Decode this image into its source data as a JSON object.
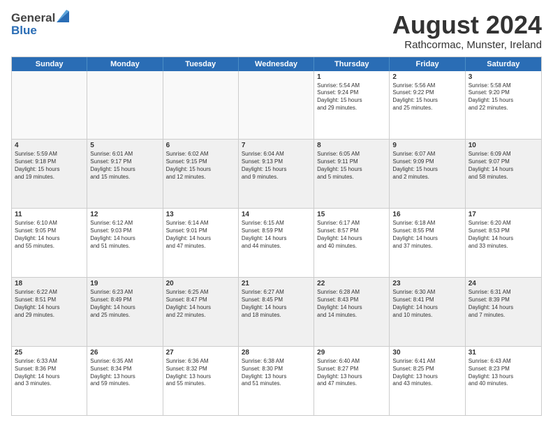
{
  "logo": {
    "general": "General",
    "blue": "Blue"
  },
  "title": "August 2024",
  "subtitle": "Rathcormac, Munster, Ireland",
  "header_days": [
    "Sunday",
    "Monday",
    "Tuesday",
    "Wednesday",
    "Thursday",
    "Friday",
    "Saturday"
  ],
  "rows": [
    [
      {
        "day": "",
        "text": "",
        "empty": true
      },
      {
        "day": "",
        "text": "",
        "empty": true
      },
      {
        "day": "",
        "text": "",
        "empty": true
      },
      {
        "day": "",
        "text": "",
        "empty": true
      },
      {
        "day": "1",
        "text": "Sunrise: 5:54 AM\nSunset: 9:24 PM\nDaylight: 15 hours\nand 29 minutes.",
        "empty": false
      },
      {
        "day": "2",
        "text": "Sunrise: 5:56 AM\nSunset: 9:22 PM\nDaylight: 15 hours\nand 25 minutes.",
        "empty": false
      },
      {
        "day": "3",
        "text": "Sunrise: 5:58 AM\nSunset: 9:20 PM\nDaylight: 15 hours\nand 22 minutes.",
        "empty": false
      }
    ],
    [
      {
        "day": "4",
        "text": "Sunrise: 5:59 AM\nSunset: 9:18 PM\nDaylight: 15 hours\nand 19 minutes.",
        "empty": false
      },
      {
        "day": "5",
        "text": "Sunrise: 6:01 AM\nSunset: 9:17 PM\nDaylight: 15 hours\nand 15 minutes.",
        "empty": false
      },
      {
        "day": "6",
        "text": "Sunrise: 6:02 AM\nSunset: 9:15 PM\nDaylight: 15 hours\nand 12 minutes.",
        "empty": false
      },
      {
        "day": "7",
        "text": "Sunrise: 6:04 AM\nSunset: 9:13 PM\nDaylight: 15 hours\nand 9 minutes.",
        "empty": false
      },
      {
        "day": "8",
        "text": "Sunrise: 6:05 AM\nSunset: 9:11 PM\nDaylight: 15 hours\nand 5 minutes.",
        "empty": false
      },
      {
        "day": "9",
        "text": "Sunrise: 6:07 AM\nSunset: 9:09 PM\nDaylight: 15 hours\nand 2 minutes.",
        "empty": false
      },
      {
        "day": "10",
        "text": "Sunrise: 6:09 AM\nSunset: 9:07 PM\nDaylight: 14 hours\nand 58 minutes.",
        "empty": false
      }
    ],
    [
      {
        "day": "11",
        "text": "Sunrise: 6:10 AM\nSunset: 9:05 PM\nDaylight: 14 hours\nand 55 minutes.",
        "empty": false
      },
      {
        "day": "12",
        "text": "Sunrise: 6:12 AM\nSunset: 9:03 PM\nDaylight: 14 hours\nand 51 minutes.",
        "empty": false
      },
      {
        "day": "13",
        "text": "Sunrise: 6:14 AM\nSunset: 9:01 PM\nDaylight: 14 hours\nand 47 minutes.",
        "empty": false
      },
      {
        "day": "14",
        "text": "Sunrise: 6:15 AM\nSunset: 8:59 PM\nDaylight: 14 hours\nand 44 minutes.",
        "empty": false
      },
      {
        "day": "15",
        "text": "Sunrise: 6:17 AM\nSunset: 8:57 PM\nDaylight: 14 hours\nand 40 minutes.",
        "empty": false
      },
      {
        "day": "16",
        "text": "Sunrise: 6:18 AM\nSunset: 8:55 PM\nDaylight: 14 hours\nand 37 minutes.",
        "empty": false
      },
      {
        "day": "17",
        "text": "Sunrise: 6:20 AM\nSunset: 8:53 PM\nDaylight: 14 hours\nand 33 minutes.",
        "empty": false
      }
    ],
    [
      {
        "day": "18",
        "text": "Sunrise: 6:22 AM\nSunset: 8:51 PM\nDaylight: 14 hours\nand 29 minutes.",
        "empty": false
      },
      {
        "day": "19",
        "text": "Sunrise: 6:23 AM\nSunset: 8:49 PM\nDaylight: 14 hours\nand 25 minutes.",
        "empty": false
      },
      {
        "day": "20",
        "text": "Sunrise: 6:25 AM\nSunset: 8:47 PM\nDaylight: 14 hours\nand 22 minutes.",
        "empty": false
      },
      {
        "day": "21",
        "text": "Sunrise: 6:27 AM\nSunset: 8:45 PM\nDaylight: 14 hours\nand 18 minutes.",
        "empty": false
      },
      {
        "day": "22",
        "text": "Sunrise: 6:28 AM\nSunset: 8:43 PM\nDaylight: 14 hours\nand 14 minutes.",
        "empty": false
      },
      {
        "day": "23",
        "text": "Sunrise: 6:30 AM\nSunset: 8:41 PM\nDaylight: 14 hours\nand 10 minutes.",
        "empty": false
      },
      {
        "day": "24",
        "text": "Sunrise: 6:31 AM\nSunset: 8:39 PM\nDaylight: 14 hours\nand 7 minutes.",
        "empty": false
      }
    ],
    [
      {
        "day": "25",
        "text": "Sunrise: 6:33 AM\nSunset: 8:36 PM\nDaylight: 14 hours\nand 3 minutes.",
        "empty": false
      },
      {
        "day": "26",
        "text": "Sunrise: 6:35 AM\nSunset: 8:34 PM\nDaylight: 13 hours\nand 59 minutes.",
        "empty": false
      },
      {
        "day": "27",
        "text": "Sunrise: 6:36 AM\nSunset: 8:32 PM\nDaylight: 13 hours\nand 55 minutes.",
        "empty": false
      },
      {
        "day": "28",
        "text": "Sunrise: 6:38 AM\nSunset: 8:30 PM\nDaylight: 13 hours\nand 51 minutes.",
        "empty": false
      },
      {
        "day": "29",
        "text": "Sunrise: 6:40 AM\nSunset: 8:27 PM\nDaylight: 13 hours\nand 47 minutes.",
        "empty": false
      },
      {
        "day": "30",
        "text": "Sunrise: 6:41 AM\nSunset: 8:25 PM\nDaylight: 13 hours\nand 43 minutes.",
        "empty": false
      },
      {
        "day": "31",
        "text": "Sunrise: 6:43 AM\nSunset: 8:23 PM\nDaylight: 13 hours\nand 40 minutes.",
        "empty": false
      }
    ]
  ],
  "colors": {
    "header_bg": "#2a6db5",
    "shaded_row": "#f0f0f0"
  }
}
